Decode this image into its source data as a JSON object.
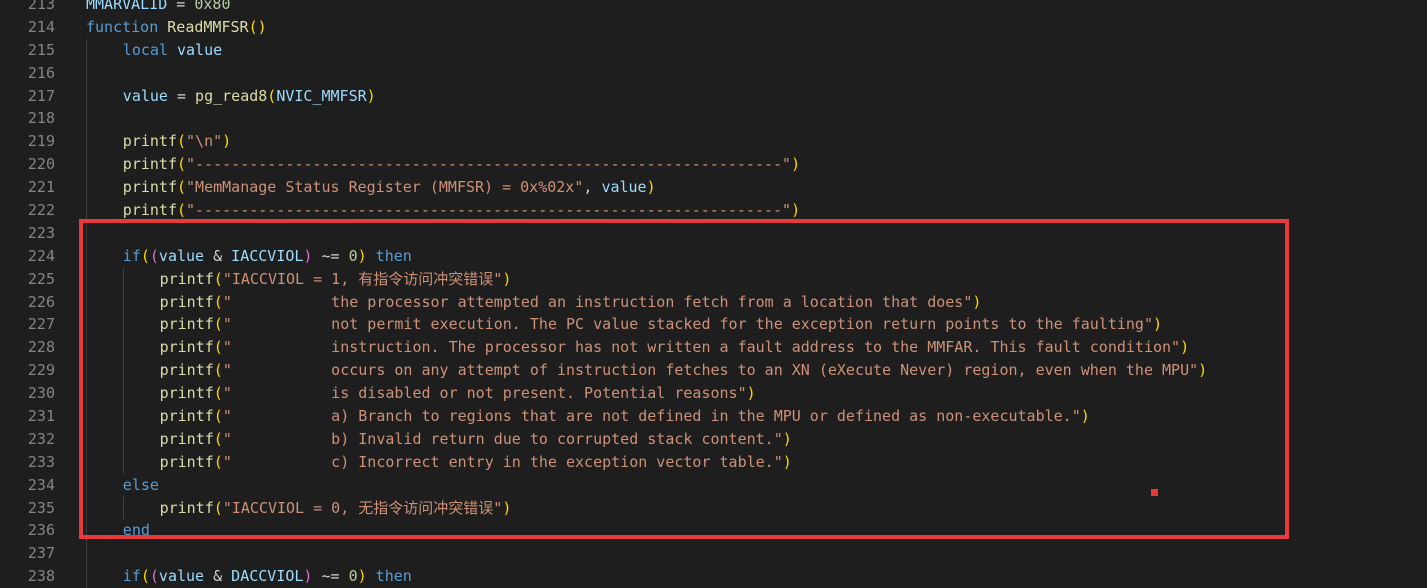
{
  "lines": [
    {
      "n": "213",
      "indent": 0,
      "segs": [
        [
          "var",
          "MMARVALID"
        ],
        [
          "op",
          " = "
        ],
        [
          "num",
          "0x80"
        ]
      ]
    },
    {
      "n": "214",
      "indent": 0,
      "segs": [
        [
          "kw",
          "function"
        ],
        [
          "op",
          " "
        ],
        [
          "fn",
          "ReadMMFSR"
        ],
        [
          "br1",
          "()"
        ]
      ]
    },
    {
      "n": "215",
      "indent": 1,
      "segs": [
        [
          "kw",
          "local"
        ],
        [
          "op",
          " "
        ],
        [
          "var",
          "value"
        ]
      ]
    },
    {
      "n": "216",
      "indent": 1,
      "segs": []
    },
    {
      "n": "217",
      "indent": 1,
      "segs": [
        [
          "var",
          "value"
        ],
        [
          "op",
          " = "
        ],
        [
          "fn",
          "pg_read8"
        ],
        [
          "br1",
          "("
        ],
        [
          "var",
          "NVIC_MMFSR"
        ],
        [
          "br1",
          ")"
        ]
      ]
    },
    {
      "n": "218",
      "indent": 1,
      "segs": []
    },
    {
      "n": "219",
      "indent": 1,
      "segs": [
        [
          "fn",
          "printf"
        ],
        [
          "br1",
          "("
        ],
        [
          "str",
          "\"\\n\""
        ],
        [
          "br1",
          ")"
        ]
      ]
    },
    {
      "n": "220",
      "indent": 1,
      "segs": [
        [
          "fn",
          "printf"
        ],
        [
          "br1",
          "("
        ],
        [
          "str",
          "\"-----------------------------------------------------------------\""
        ],
        [
          "br1",
          ")"
        ]
      ]
    },
    {
      "n": "221",
      "indent": 1,
      "segs": [
        [
          "fn",
          "printf"
        ],
        [
          "br1",
          "("
        ],
        [
          "str",
          "\"MemManage Status Register (MMFSR) = 0x%02x\""
        ],
        [
          "op",
          ", "
        ],
        [
          "var",
          "value"
        ],
        [
          "br1",
          ")"
        ]
      ]
    },
    {
      "n": "222",
      "indent": 1,
      "segs": [
        [
          "fn",
          "printf"
        ],
        [
          "br1",
          "("
        ],
        [
          "str",
          "\"-----------------------------------------------------------------\""
        ],
        [
          "br1",
          ")"
        ]
      ]
    },
    {
      "n": "223",
      "indent": 1,
      "segs": []
    },
    {
      "n": "224",
      "indent": 1,
      "segs": [
        [
          "kw",
          "if"
        ],
        [
          "br1",
          "("
        ],
        [
          "br2",
          "("
        ],
        [
          "var",
          "value"
        ],
        [
          "op",
          " & "
        ],
        [
          "var",
          "IACCVIOL"
        ],
        [
          "br2",
          ")"
        ],
        [
          "op",
          " ~= "
        ],
        [
          "num",
          "0"
        ],
        [
          "br1",
          ")"
        ],
        [
          "op",
          " "
        ],
        [
          "kw",
          "then"
        ]
      ]
    },
    {
      "n": "225",
      "indent": 2,
      "segs": [
        [
          "fn",
          "printf"
        ],
        [
          "br1",
          "("
        ],
        [
          "str",
          "\"IACCVIOL = 1, 有指令访问冲突错误\""
        ],
        [
          "br1",
          ")"
        ]
      ]
    },
    {
      "n": "226",
      "indent": 2,
      "segs": [
        [
          "fn",
          "printf"
        ],
        [
          "br1",
          "("
        ],
        [
          "str",
          "\"           the processor attempted an instruction fetch from a location that does\""
        ],
        [
          "br1",
          ")"
        ]
      ]
    },
    {
      "n": "227",
      "indent": 2,
      "segs": [
        [
          "fn",
          "printf"
        ],
        [
          "br1",
          "("
        ],
        [
          "str",
          "\"           not permit execution. The PC value stacked for the exception return points to the faulting\""
        ],
        [
          "br1",
          ")"
        ]
      ]
    },
    {
      "n": "228",
      "indent": 2,
      "segs": [
        [
          "fn",
          "printf"
        ],
        [
          "br1",
          "("
        ],
        [
          "str",
          "\"           instruction. The processor has not written a fault address to the MMFAR. This fault condition\""
        ],
        [
          "br1",
          ")"
        ]
      ]
    },
    {
      "n": "229",
      "indent": 2,
      "segs": [
        [
          "fn",
          "printf"
        ],
        [
          "br1",
          "("
        ],
        [
          "str",
          "\"           occurs on any attempt of instruction fetches to an XN (eXecute Never) region, even when the MPU\""
        ],
        [
          "br1",
          ")"
        ]
      ]
    },
    {
      "n": "230",
      "indent": 2,
      "segs": [
        [
          "fn",
          "printf"
        ],
        [
          "br1",
          "("
        ],
        [
          "str",
          "\"           is disabled or not present. Potential reasons\""
        ],
        [
          "br1",
          ")"
        ]
      ]
    },
    {
      "n": "231",
      "indent": 2,
      "segs": [
        [
          "fn",
          "printf"
        ],
        [
          "br1",
          "("
        ],
        [
          "str",
          "\"           a) Branch to regions that are not defined in the MPU or defined as non-executable.\""
        ],
        [
          "br1",
          ")"
        ]
      ]
    },
    {
      "n": "232",
      "indent": 2,
      "segs": [
        [
          "fn",
          "printf"
        ],
        [
          "br1",
          "("
        ],
        [
          "str",
          "\"           b) Invalid return due to corrupted stack content.\""
        ],
        [
          "br1",
          ")"
        ]
      ]
    },
    {
      "n": "233",
      "indent": 2,
      "segs": [
        [
          "fn",
          "printf"
        ],
        [
          "br1",
          "("
        ],
        [
          "str",
          "\"           c) Incorrect entry in the exception vector table.\""
        ],
        [
          "br1",
          ")"
        ]
      ]
    },
    {
      "n": "234",
      "indent": 1,
      "segs": [
        [
          "kw",
          "else"
        ]
      ]
    },
    {
      "n": "235",
      "indent": 2,
      "segs": [
        [
          "fn",
          "printf"
        ],
        [
          "br1",
          "("
        ],
        [
          "str",
          "\"IACCVIOL = 0, 无指令访问冲突错误\""
        ],
        [
          "br1",
          ")"
        ]
      ]
    },
    {
      "n": "236",
      "indent": 1,
      "segs": [
        [
          "kw",
          "end"
        ]
      ]
    },
    {
      "n": "237",
      "indent": 1,
      "segs": []
    },
    {
      "n": "238",
      "indent": 1,
      "segs": [
        [
          "kw",
          "if"
        ],
        [
          "br1",
          "("
        ],
        [
          "br2",
          "("
        ],
        [
          "var",
          "value"
        ],
        [
          "op",
          " & "
        ],
        [
          "var",
          "DACCVIOL"
        ],
        [
          "br2",
          ")"
        ],
        [
          "op",
          " ~= "
        ],
        [
          "num",
          "0"
        ],
        [
          "br1",
          ")"
        ],
        [
          "op",
          " "
        ],
        [
          "kw",
          "then"
        ]
      ]
    }
  ],
  "colors": {
    "background": "#1e1e1e",
    "highlight_box": "#e83a3a",
    "keyword": "#569cd6",
    "function": "#dcdcaa",
    "variable": "#9cdcfe",
    "string": "#ce9178",
    "number": "#b5cea8"
  }
}
